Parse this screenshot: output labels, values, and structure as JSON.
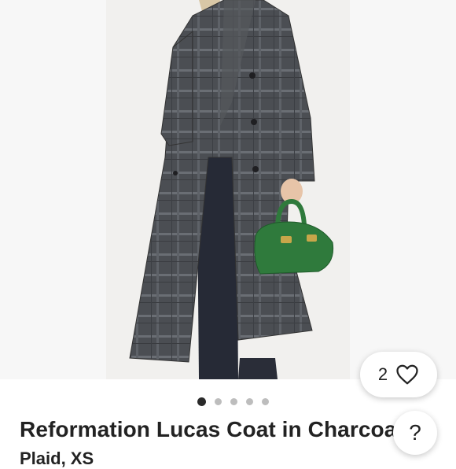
{
  "gallery": {
    "image_subject": "model wearing grey plaid long coat holding green handbag",
    "slide_count": 5,
    "active_slide": 0
  },
  "like": {
    "count": "2",
    "icon": "heart-icon"
  },
  "listing": {
    "title": "Reformation Lucas Coat in Charcoal Plaid",
    "subtitle_fragment": "Plaid, XS"
  },
  "help": {
    "label": "?",
    "icon": "question-icon"
  },
  "colors": {
    "coat": "#4a4d52",
    "bag": "#2f7a3c",
    "background": "#f1f0ee"
  }
}
